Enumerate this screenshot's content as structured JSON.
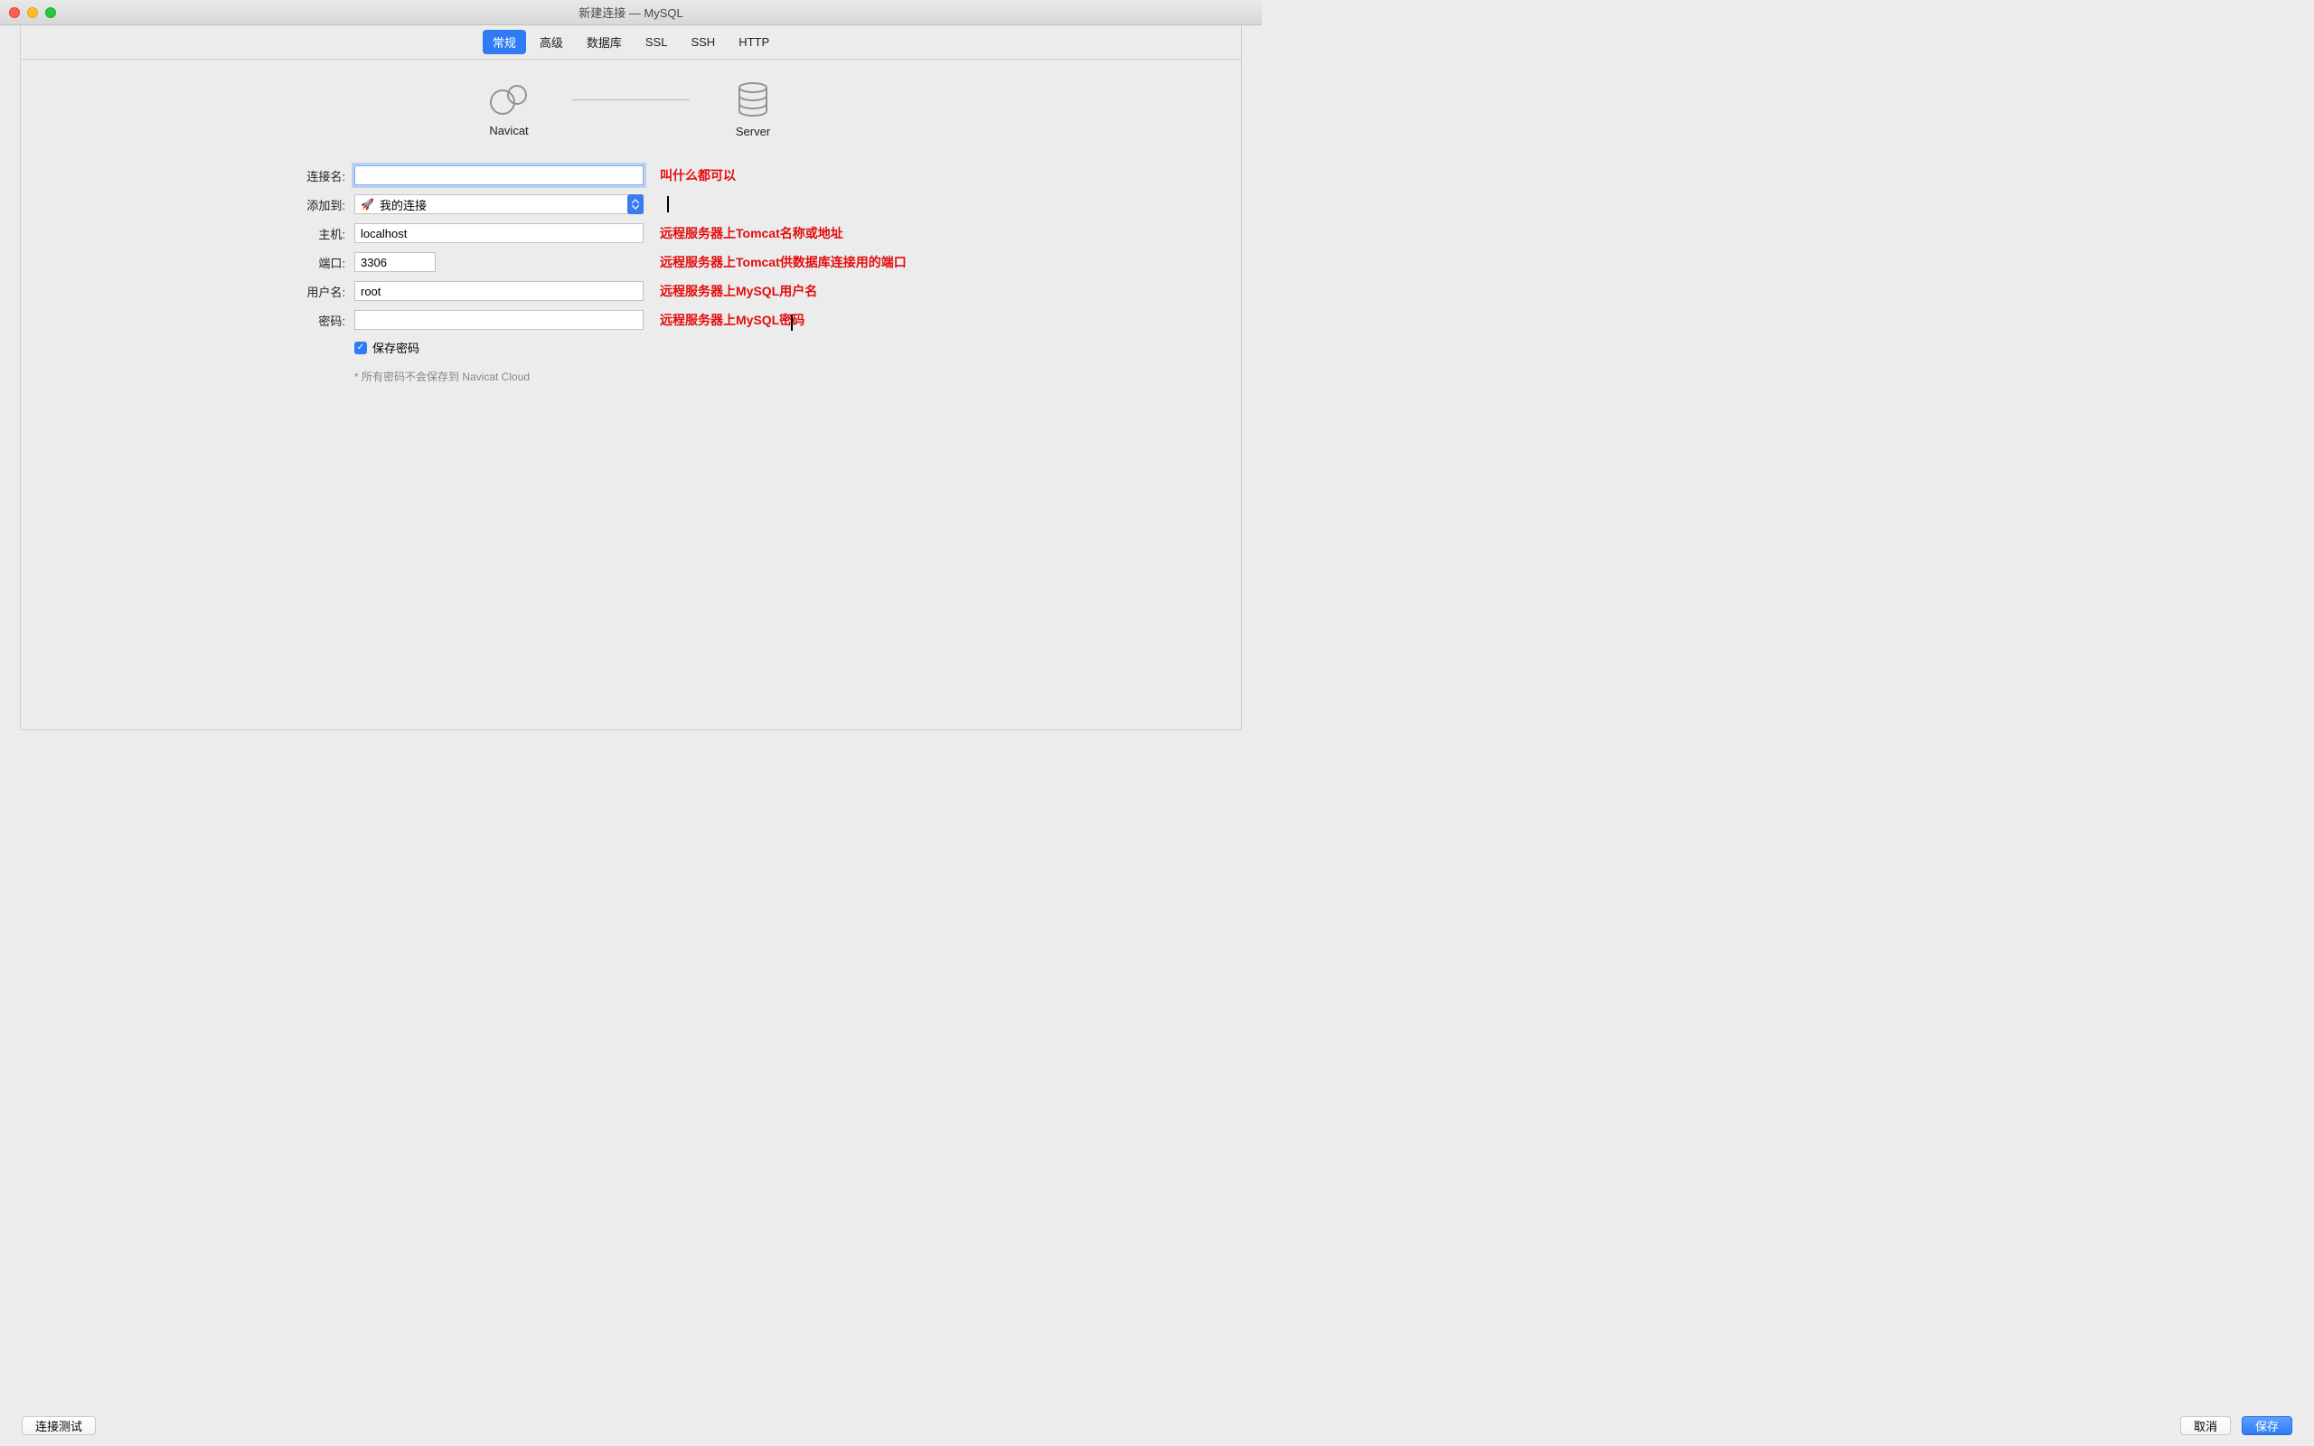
{
  "window": {
    "title": "新建连接 — MySQL"
  },
  "tabs": {
    "general": "常规",
    "advanced": "高级",
    "database": "数据库",
    "ssl": "SSL",
    "ssh": "SSH",
    "http": "HTTP"
  },
  "icons": {
    "navicat_label": "Navicat",
    "server_label": "Server"
  },
  "form": {
    "connection_name_label": "连接名:",
    "connection_name_value": "",
    "add_to_label": "添加到:",
    "add_to_value": "我的连接",
    "host_label": "主机:",
    "host_value": "localhost",
    "port_label": "端口:",
    "port_value": "3306",
    "username_label": "用户名:",
    "username_value": "root",
    "password_label": "密码:",
    "password_value": "",
    "save_password_label": "保存密码",
    "note": "* 所有密码不会保存到 Navicat Cloud"
  },
  "annotations": {
    "connection_name": "叫什么都可以",
    "host": "远程服务器上Tomcat名称或地址",
    "port": "远程服务器上Tomcat供数据库连接用的端口",
    "username": "远程服务器上MySQL用户名",
    "password": "远程服务器上MySQL密码"
  },
  "buttons": {
    "test": "连接测试",
    "cancel": "取消",
    "save": "保存"
  }
}
